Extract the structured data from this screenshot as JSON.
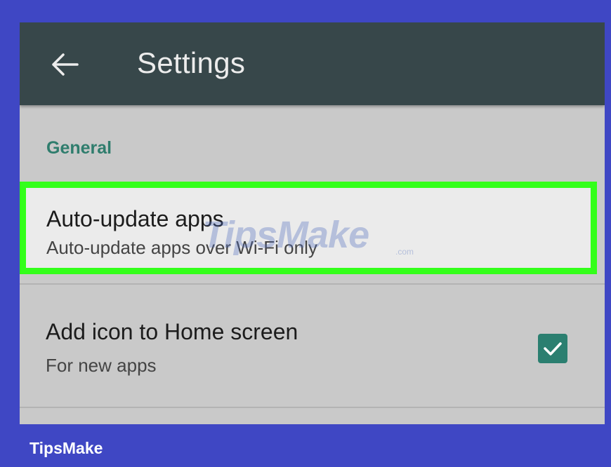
{
  "appbar": {
    "title": "Settings",
    "back_icon": "arrow-left-icon"
  },
  "section": {
    "header": "General"
  },
  "settings": [
    {
      "title": "Auto-update apps",
      "subtitle": "Auto-update apps over Wi-Fi only",
      "highlighted": true
    },
    {
      "title": "Add icon to Home screen",
      "subtitle": "For new apps",
      "checked": true
    }
  ],
  "watermark": {
    "text": "TipsMake",
    "suffix": ".com"
  },
  "footer": {
    "brand": "TipsMake"
  },
  "colors": {
    "appbar": "#37474a",
    "accent": "#2f7d6d",
    "highlight_border": "#33ff1a",
    "frame": "#3f47c4"
  }
}
